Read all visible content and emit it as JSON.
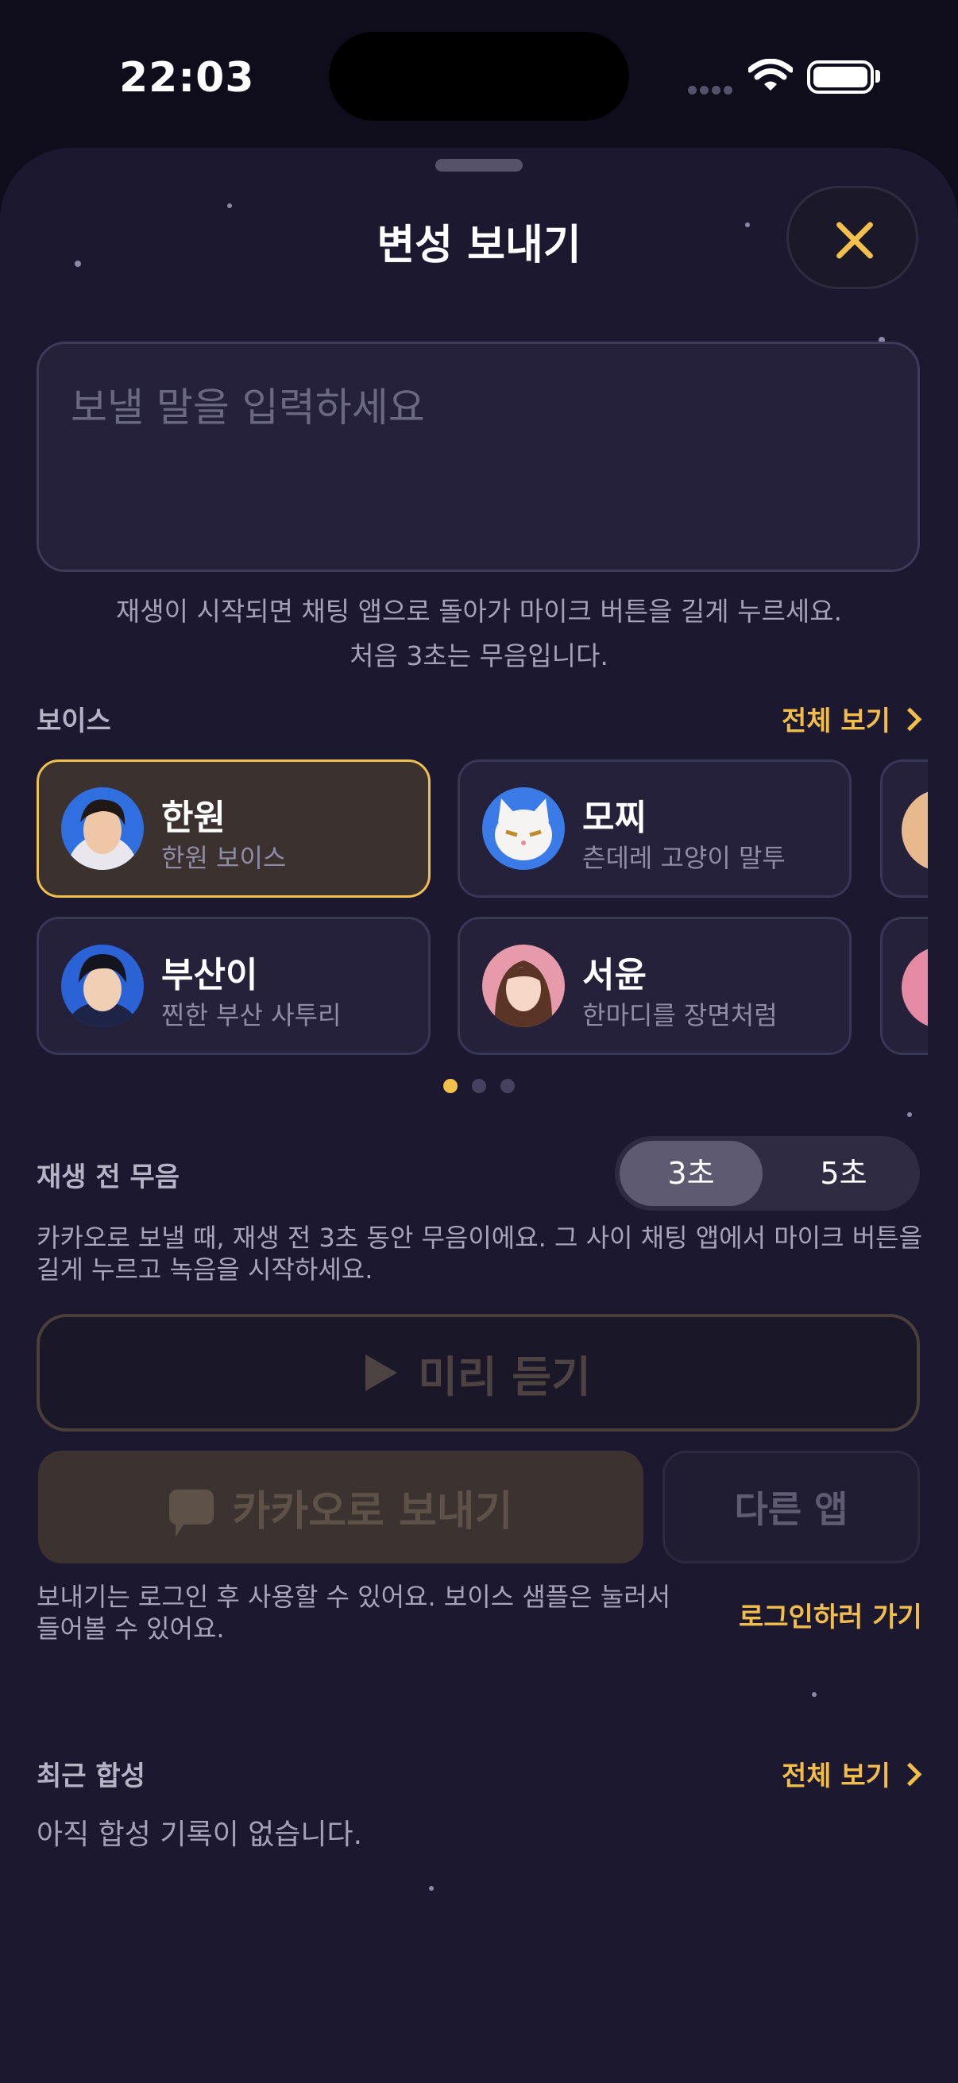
{
  "status": {
    "time": "22:03"
  },
  "sheet": {
    "title": "변성 보내기"
  },
  "input": {
    "placeholder": "보낼 말을 입력하세요"
  },
  "hint": {
    "line1": "재생이 시작되면 채팅 앱으로 돌아가 마이크 버튼을 길게 누르세요.",
    "line2": "처음 3초는 무음입니다."
  },
  "voices": {
    "label": "보이스",
    "see_all": "전체 보기",
    "items": [
      {
        "name": "한원",
        "desc": "한원 보이스",
        "selected": true
      },
      {
        "name": "모찌",
        "desc": "츤데레 고양이 말투",
        "selected": false
      },
      {
        "name": "부산이",
        "desc": "찐한 부산 사투리",
        "selected": false
      },
      {
        "name": "서윤",
        "desc": "한마디를 장면처럼",
        "selected": false
      }
    ],
    "page_count": 3,
    "active_page": 1
  },
  "silence": {
    "label": "재생 전 무음",
    "options": [
      "3초",
      "5초"
    ],
    "selected": "3초",
    "desc": "카카오로 보낼 때, 재생 전 3초 동안 무음이에요. 그 사이 채팅 앱에서 마이크 버튼을 길게 누르고 녹음을 시작하세요."
  },
  "actions": {
    "preview": "미리 듣기",
    "kakao": "카카오로 보내기",
    "other_app": "다른 앱",
    "login_note": "보내기는 로그인 후 사용할 수 있어요. 보이스 샘플은 눌러서 들어볼 수 있어요.",
    "login_link": "로그인하러 가기"
  },
  "recent": {
    "label": "최근 합성",
    "see_all": "전체 보기",
    "empty": "아직 합성 기록이 없습니다."
  },
  "colors": {
    "accent": "#f3bd4a",
    "background": "#1b1830"
  }
}
